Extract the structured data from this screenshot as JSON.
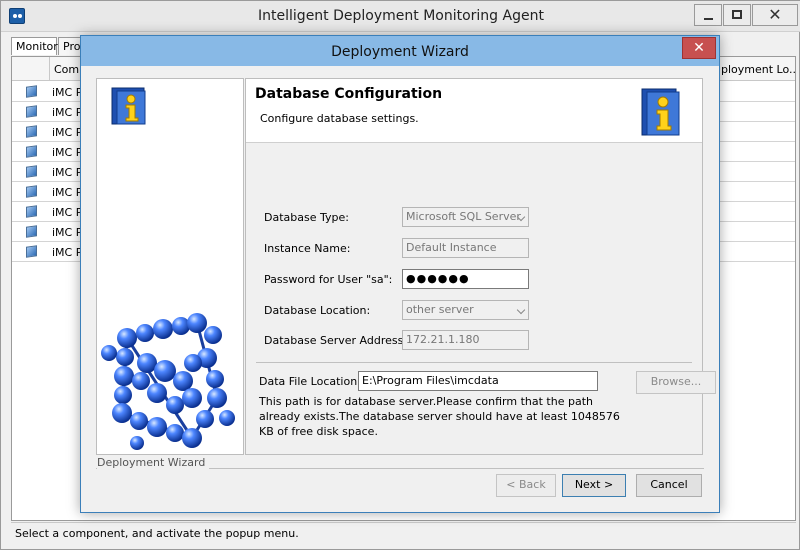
{
  "main_window": {
    "title": "Intelligent Deployment Monitoring Agent",
    "tabs": [
      "Monitor",
      "Proc"
    ],
    "grid": {
      "columns": [
        "",
        "Comp",
        "ployment Lo..."
      ],
      "rows": [
        "iMC Pla",
        "iMC Pla",
        "iMC Pla",
        "iMC Pla",
        "iMC Pla",
        "iMC Pla",
        "iMC Pla",
        "iMC Pla",
        "iMC Pla"
      ]
    },
    "status_text": "Select a component, and activate the popup menu."
  },
  "dialog": {
    "title": "Deployment Wizard",
    "close_glyph": "✕",
    "header": {
      "title": "Database Configuration",
      "subtitle": "Configure database settings."
    },
    "fields": [
      {
        "label": "Database Type:",
        "value": "Microsoft SQL Server"
      },
      {
        "label": "Instance Name:",
        "value": "Default Instance"
      },
      {
        "label": "Password for User \"sa\":",
        "value": "●●●●●●"
      },
      {
        "label": "Database Location:",
        "value": "other server"
      },
      {
        "label": "Database Server Address:",
        "value": "172.21.1.180"
      }
    ],
    "data_file": {
      "label": "Data File Location:",
      "value": "E:\\Program Files\\imcdata",
      "browse_label": "Browse...",
      "note": "This path is for database server.Please confirm that the path already exists.The database server should have at least 1048576 KB of free disk space."
    },
    "footer_label": "Deployment Wizard",
    "buttons": {
      "back": "< Back",
      "next": "Next >",
      "cancel": "Cancel"
    },
    "colors": {
      "title_bar": "#88b9e6",
      "close_button": "#c75050",
      "side_graphic": "#1f5fd1"
    },
    "icons": [
      "info-book-icon",
      "molecule-cube-graphic"
    ]
  }
}
